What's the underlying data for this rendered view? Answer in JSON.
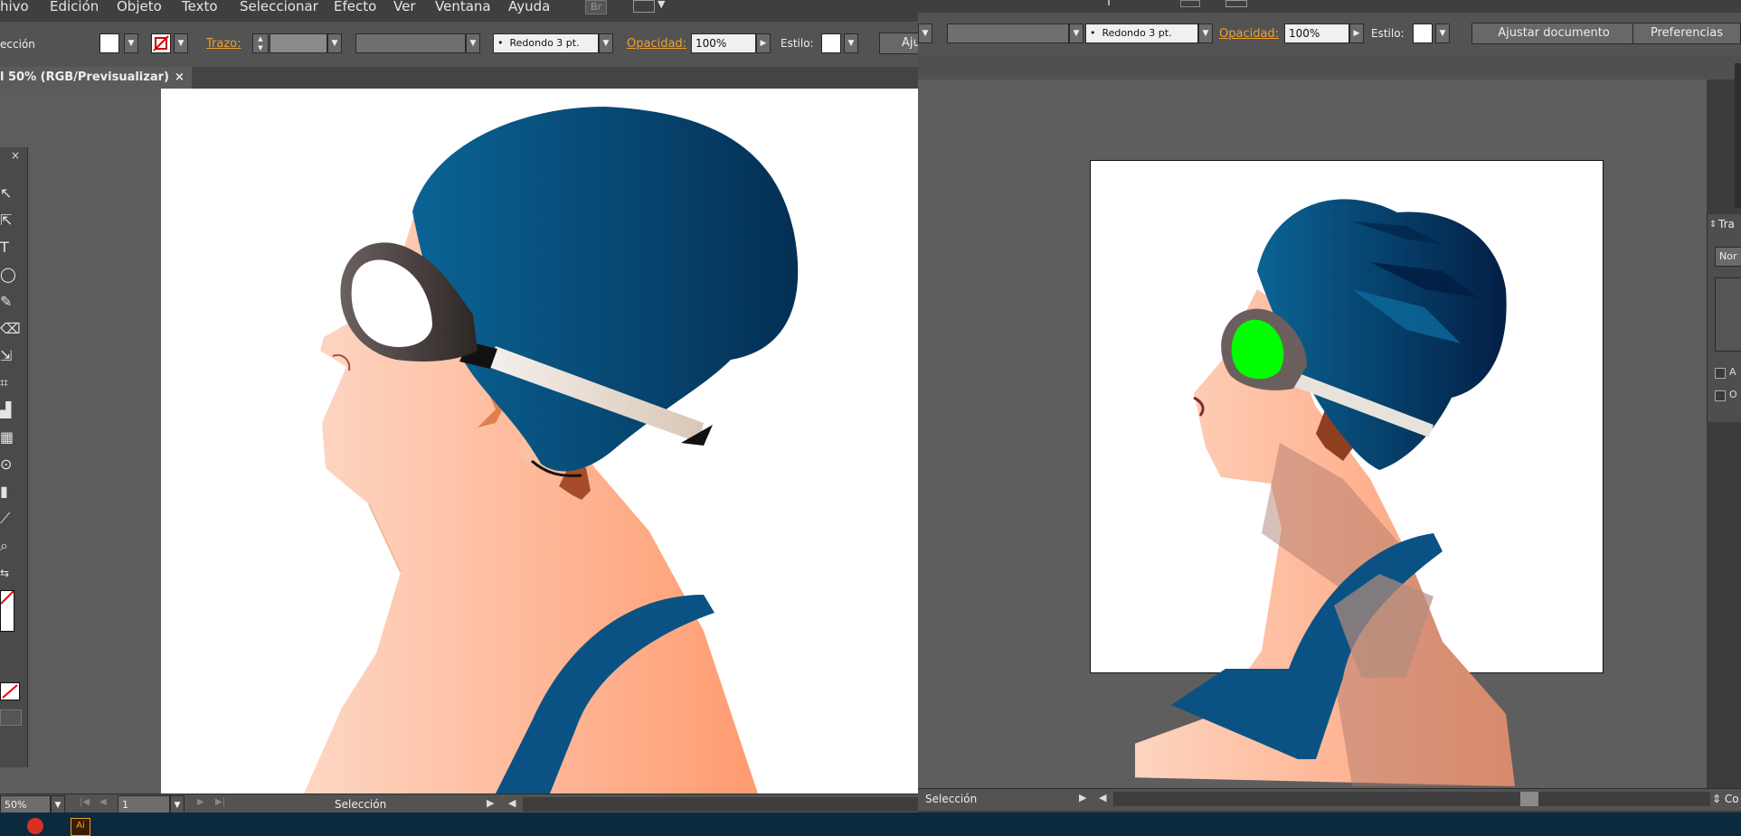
{
  "menubar": {
    "items": [
      "hivo",
      "Edición",
      "Objeto",
      "Texto",
      "Seleccionar",
      "Efecto",
      "Ver",
      "Ventana",
      "Ayuda"
    ],
    "br_label": "Br"
  },
  "left_control": {
    "selection_label": "ección",
    "stroke_label": "Trazo:",
    "brush_value": "Redondo 3 pt.",
    "opacity_label": "Opacidad:",
    "opacity_value": "100%",
    "style_label": "Estilo:",
    "cut_button": "Aju"
  },
  "right_control": {
    "brush_value": "Redondo 3 pt.",
    "opacity_label": "Opacidad:",
    "opacity_value": "100%",
    "style_label": "Estilo:",
    "fit_document_button": "Ajustar documento",
    "preferences_button": "Preferencias"
  },
  "document_tab": {
    "title": "l 50% (RGB/Previsualizar)",
    "close": "×"
  },
  "left_status": {
    "zoom": "50%",
    "page": "1",
    "tool": "Selección"
  },
  "right_status": {
    "tool": "Selección"
  },
  "right_panel": {
    "header": "Tra",
    "field": "Nor",
    "check_a": "A",
    "check_b": "O",
    "bottom_tab": "Co"
  },
  "colors": {
    "cap_dark": "#063a63",
    "cap_light": "#0a5b8c",
    "skin_light": "#fdd0b8",
    "skin_dark": "#ff9f76",
    "lens_green": "#00ff00",
    "ui_panel": "#535353",
    "canvas_gray": "#5d5d5d"
  }
}
